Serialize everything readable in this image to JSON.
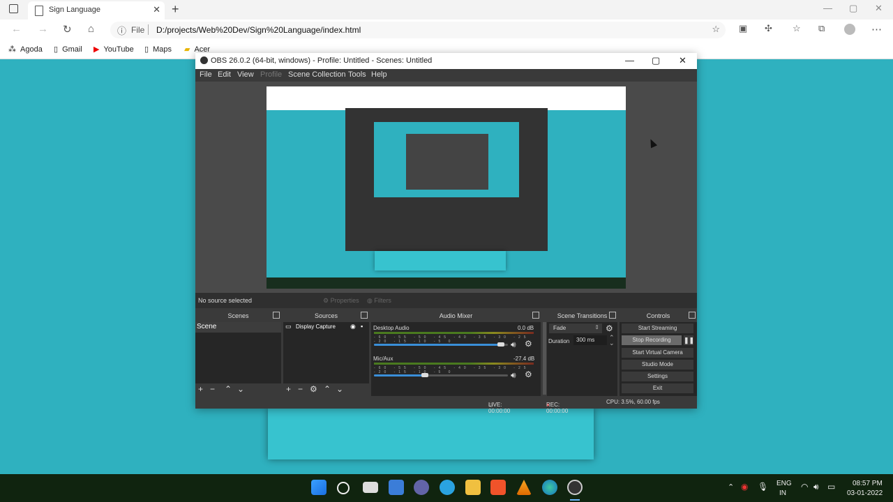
{
  "browser": {
    "tab_title": "Sign Language",
    "new_tab": "+",
    "tab_close": "✕",
    "address_prefix": "File",
    "url": "D:/projects/Web%20Dev/Sign%20Language/index.html",
    "bookmarks": [
      "Agoda",
      "Gmail",
      "YouTube",
      "Maps",
      "Acer"
    ]
  },
  "obs": {
    "title": "OBS 26.0.2 (64-bit, windows) - Profile: Untitled - Scenes: Untitled",
    "menu": [
      "File",
      "Edit",
      "View",
      "Profile",
      "Scene Collection",
      "Tools",
      "Help"
    ],
    "no_source": "No source selected",
    "properties": "Properties",
    "filters": "Filters",
    "docks": {
      "scenes": "Scenes",
      "sources": "Sources",
      "mixer": "Audio Mixer",
      "transitions": "Scene Transitions",
      "controls": "Controls"
    },
    "scene_item": "Scene",
    "source_item": "Display Capture",
    "mixer": [
      {
        "name": "Desktop Audio",
        "db": "0.0 dB",
        "level": 0.95
      },
      {
        "name": "Mic/Aux",
        "db": "-27.4 dB",
        "level": 0.38
      }
    ],
    "mixer_scale": "-60 -55 -50 -45 -40 -35 -30 -25 -20 -15 -10 -5 0",
    "transition": "Fade",
    "duration_label": "Duration",
    "duration_value": "300 ms",
    "controls": [
      "Start Streaming",
      "Stop Recording",
      "Start Virtual Camera",
      "Studio Mode",
      "Settings",
      "Exit"
    ],
    "status": {
      "live": "LIVE: 00:00:00",
      "rec": "REC: 00:00:00",
      "cpu": "CPU: 3.5%, 60.00 fps"
    }
  },
  "taskbar": {
    "lang1": "ENG",
    "lang2": "IN",
    "time": "08:57 PM",
    "date": "03-01-2022"
  }
}
